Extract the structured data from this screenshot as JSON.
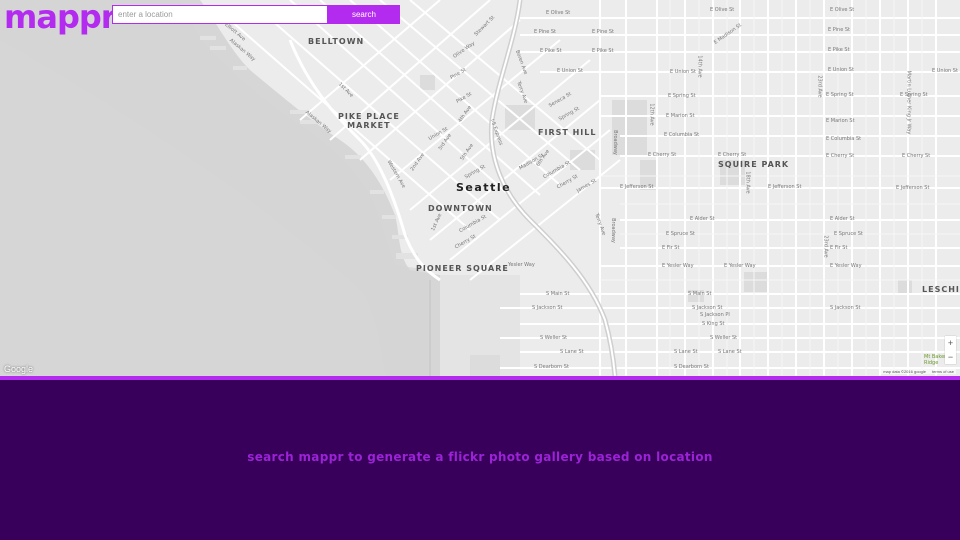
{
  "brand": {
    "name": "mappr"
  },
  "search": {
    "placeholder": "enter a location",
    "value": "",
    "button_label": "search"
  },
  "map": {
    "city_label": "Seattle",
    "neighborhoods": [
      "BELLTOWN",
      "PIKE PLACE\nMARKET",
      "FIRST HILL",
      "DOWNTOWN",
      "PIONEER SQUARE",
      "SQUIRE PARK",
      "LESCHI"
    ],
    "streets": [
      "E Olive St",
      "E Pine St",
      "E Pike St",
      "E Union St",
      "E Madison St",
      "E Spring St",
      "E Marion St",
      "E Columbia St",
      "E Cherry St",
      "E Jefferson St",
      "E Alder St",
      "E Fir St",
      "E Spruce St",
      "E Yesler Way",
      "S Main St",
      "S Jackson St",
      "S King St",
      "S Weller St",
      "S Lane St",
      "S Dearborn St",
      "Yesler Way",
      "1st Ave",
      "2nd Ave",
      "3rd Ave",
      "4th Ave",
      "5th Ave",
      "6th Ave",
      "Western Ave",
      "Alaskan Way",
      "Elliott Ave",
      "Pine St",
      "Pike St",
      "Union St",
      "Seneca St",
      "Spring St",
      "Madison St",
      "Columbia St",
      "Cherry St",
      "James St",
      "Olive Way",
      "Stewart St",
      "Boren Ave",
      "Terry Ave",
      "Broadway",
      "12th Ave",
      "14th Ave",
      "18th Ave",
      "23rd Ave",
      "Martin Luther King Jr Way",
      "I-5 Express",
      "S Jackson Pl",
      "Mt Baker\nRidge"
    ],
    "google_label": "Google",
    "attribution": "map data ©2016 google",
    "terms": "terms of use",
    "zoom_in": "+",
    "zoom_out": "−"
  },
  "footer": {
    "message": "search mappr to generate a flickr photo gallery based on location"
  },
  "colors": {
    "accent": "#b42bf0",
    "footer_bg": "#38005a",
    "footer_text": "#9b22d6",
    "water": "#d4d4d4",
    "land": "#e9e9e9",
    "road": "#ffffff"
  }
}
